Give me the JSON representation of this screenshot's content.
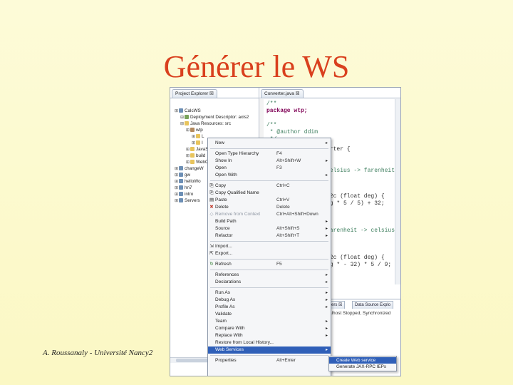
{
  "slide": {
    "title": "Générer le WS",
    "footer": "A. Roussanaly - Université Nancy2"
  },
  "explorer": {
    "tab_label": "Project Explorer ☒",
    "tree": [
      {
        "label": "CalcWS",
        "icon": "project-icon"
      },
      {
        "label": "Deployment Descriptor: axis2",
        "icon": "descriptor-icon"
      },
      {
        "label": "Java Resources: src",
        "icon": "folder-icon"
      },
      {
        "label": "wtp",
        "icon": "package-icon"
      },
      {
        "label": "L",
        "icon": "file-icon"
      },
      {
        "label": "I",
        "icon": "file-icon"
      },
      {
        "label": "JavaS",
        "icon": "folder-icon"
      },
      {
        "label": "build",
        "icon": "folder-icon"
      },
      {
        "label": "WebC",
        "icon": "folder-icon"
      },
      {
        "label": "changeW",
        "icon": "project-icon"
      },
      {
        "label": "gw",
        "icon": "project-icon"
      },
      {
        "label": "helloWo",
        "icon": "project-icon"
      },
      {
        "label": "hn7",
        "icon": "project-icon"
      },
      {
        "label": "intro",
        "icon": "project-icon"
      },
      {
        "label": "Servers",
        "icon": "project-icon"
      }
    ]
  },
  "editor": {
    "tab_label": "Converter.java ☒",
    "lines": [
      {
        "text": "/**",
        "kind": "cm"
      },
      {
        "text": "package wtp;",
        "kind": "kw"
      },
      {
        "text": "",
        "kind": "n"
      },
      {
        "text": "/**",
        "kind": "cm"
      },
      {
        "text": " * @author ddim",
        "kind": "cm"
      },
      {
        "text": " */",
        "kind": "cm"
      }
    ],
    "fragments": [
      {
        "text": "erter {",
        "kind": "n"
      },
      {
        "text": "celsius -> farenheit",
        "kind": "cm"
      },
      {
        "text": "f2c (float deg) {",
        "kind": "n"
      },
      {
        "text": "eg * 5 / 5) + 32;",
        "kind": "n"
      },
      {
        "text": "farenheit -> celsius",
        "kind": "cm"
      },
      {
        "text": "f2c (float deg) {",
        "kind": "n"
      },
      {
        "text": "eg * - 32) * 5 / 9;",
        "kind": "n"
      }
    ]
  },
  "servers_pane": {
    "tabs": [
      "vers ☒",
      "Data Source Explo"
    ],
    "row": "alhost  Stopped, Synchronized"
  },
  "context_menu": {
    "items": [
      {
        "label": "New",
        "shortcut": "",
        "submenu": true,
        "icon": ""
      },
      {
        "sep": true
      },
      {
        "label": "Open Type Hierarchy",
        "shortcut": "F4"
      },
      {
        "label": "Show In",
        "shortcut": "Alt+Shift+W",
        "submenu": true
      },
      {
        "label": "Open",
        "shortcut": "F3"
      },
      {
        "label": "Open With",
        "shortcut": "",
        "submenu": true
      },
      {
        "sep": true
      },
      {
        "label": "Copy",
        "shortcut": "Ctrl+C",
        "icon": "copy-icon"
      },
      {
        "label": "Copy Qualified Name",
        "shortcut": "",
        "icon": "copy-icon"
      },
      {
        "label": "Paste",
        "shortcut": "Ctrl+V",
        "icon": "paste-icon"
      },
      {
        "label": "Delete",
        "shortcut": "Delete",
        "icon": "delete-icon"
      },
      {
        "label": "Remove from Context",
        "shortcut": "Ctrl+Alt+Shift+Down",
        "disabled": true,
        "icon": "remove-icon"
      },
      {
        "label": "Build Path",
        "shortcut": "",
        "submenu": true
      },
      {
        "label": "Source",
        "shortcut": "Alt+Shift+S",
        "submenu": true
      },
      {
        "label": "Refactor",
        "shortcut": "Alt+Shift+T",
        "submenu": true
      },
      {
        "sep": true
      },
      {
        "label": "Import...",
        "shortcut": "",
        "icon": "import-icon"
      },
      {
        "label": "Export...",
        "shortcut": "",
        "icon": "export-icon"
      },
      {
        "sep": true
      },
      {
        "label": "Refresh",
        "shortcut": "F5",
        "icon": "refresh-icon"
      },
      {
        "sep": true
      },
      {
        "label": "References",
        "shortcut": "",
        "submenu": true
      },
      {
        "label": "Declarations",
        "shortcut": "",
        "submenu": true
      },
      {
        "sep": true
      },
      {
        "label": "Run As",
        "shortcut": "",
        "submenu": true
      },
      {
        "label": "Debug As",
        "shortcut": "",
        "submenu": true
      },
      {
        "label": "Profile As",
        "shortcut": "",
        "submenu": true
      },
      {
        "label": "Validate",
        "shortcut": ""
      },
      {
        "label": "Team",
        "shortcut": "",
        "submenu": true
      },
      {
        "label": "Compare With",
        "shortcut": "",
        "submenu": true
      },
      {
        "label": "Replace With",
        "shortcut": "",
        "submenu": true
      },
      {
        "label": "Restore from Local History...",
        "shortcut": ""
      },
      {
        "label": "Web Services",
        "shortcut": "",
        "submenu": true,
        "selected": true
      },
      {
        "sep": true
      },
      {
        "label": "Properties",
        "shortcut": "Alt+Enter"
      }
    ]
  },
  "submenu": {
    "items": [
      {
        "label": "Create Web service",
        "selected": true
      },
      {
        "label": "Generate JAX-RPC IEPs",
        "selected": false
      }
    ]
  },
  "colors": {
    "title": "#d9401e",
    "selection": "#2f5fb8",
    "background": "#fcf9cc"
  }
}
